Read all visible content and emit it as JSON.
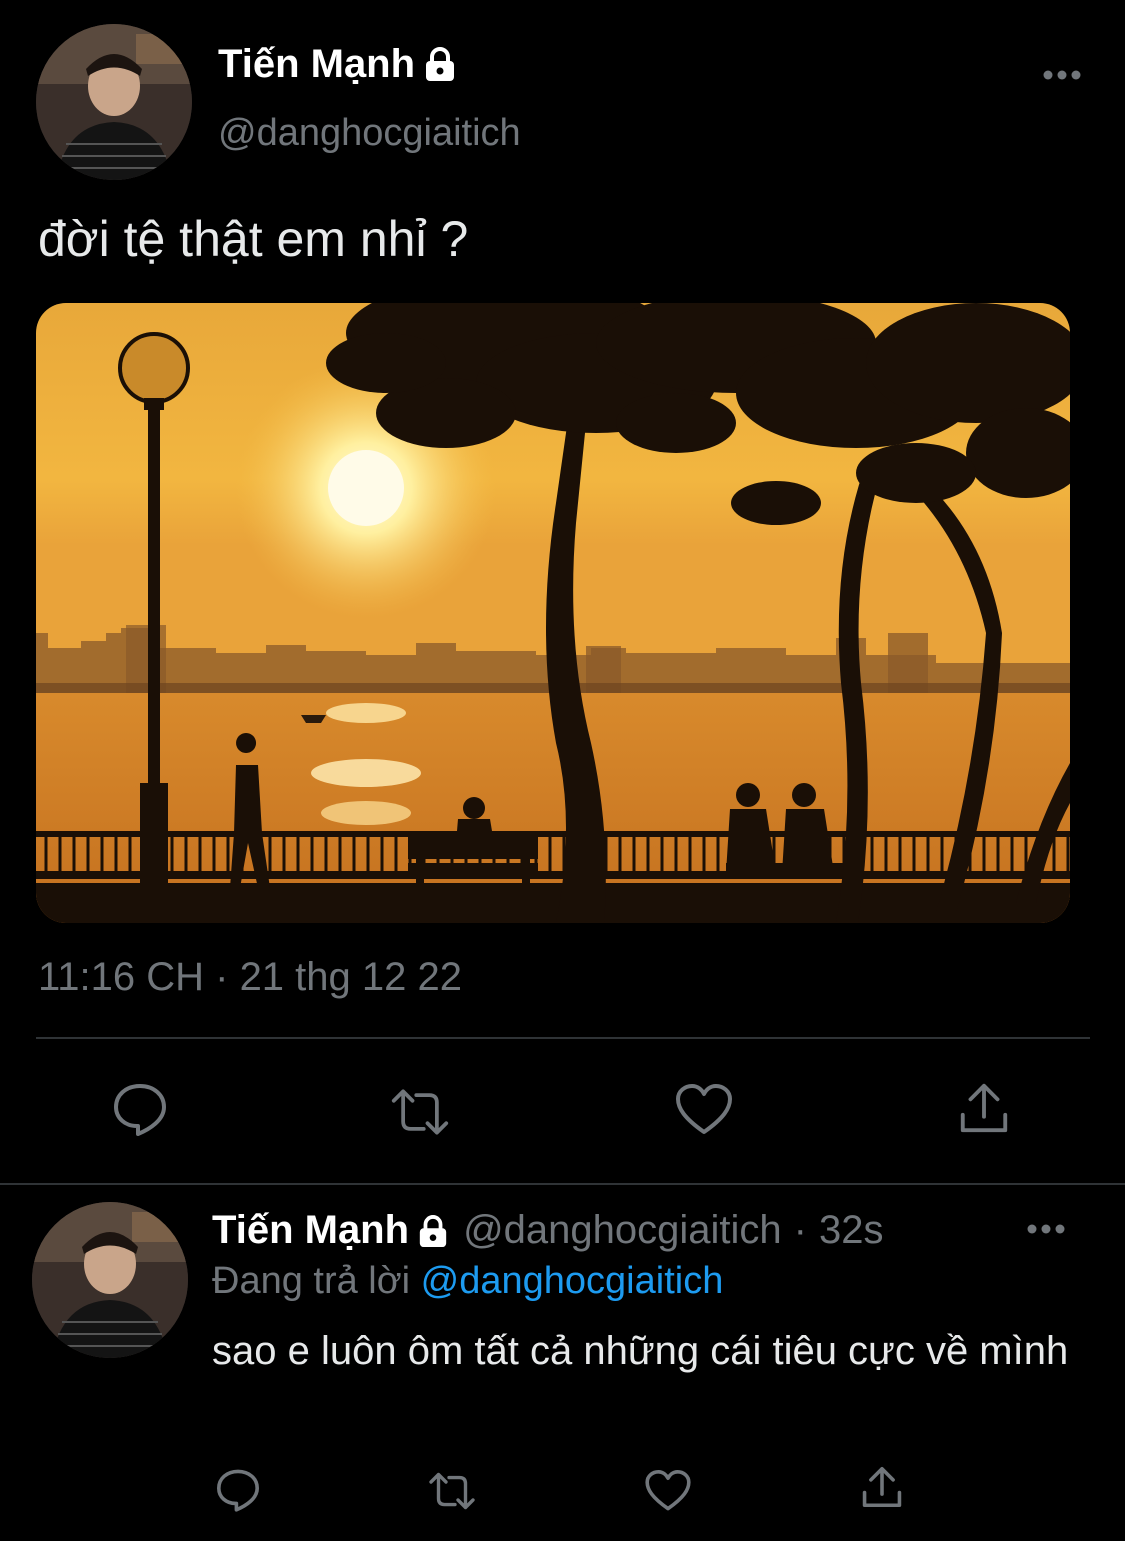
{
  "main_tweet": {
    "author_name": "Tiến Mạnh",
    "author_handle": "@danghocgiaitich",
    "text": "đời tệ thật em nhỉ ?",
    "timestamp": "11:16 CH · 21 thg 12 22",
    "lock_icon": "lock-icon",
    "more_icon": "more-horizontal-icon"
  },
  "actions": {
    "reply_icon": "comment-icon",
    "retweet_icon": "retweet-icon",
    "like_icon": "heart-icon",
    "share_icon": "share-icon"
  },
  "reply_tweet": {
    "author_name": "Tiến Mạnh",
    "author_handle": "@danghocgiaitich",
    "separator": "·",
    "time_ago": "32s",
    "replying_prefix": "Đang trả lời",
    "replying_to": "@danghocgiaitich",
    "text": "sao e luôn ôm tất cả những cái tiêu cực về mình"
  },
  "colors": {
    "background": "#000000",
    "secondary_text": "#71767b",
    "accent": "#1d9bf0",
    "divider": "#2f3336"
  }
}
